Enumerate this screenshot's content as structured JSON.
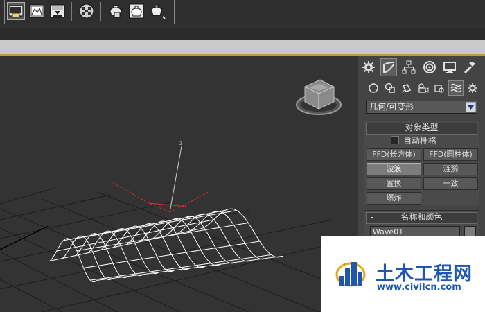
{
  "toolbar": {
    "buttons": [
      "render-setup",
      "rendered-frame-window",
      "render-production",
      "material-editor",
      "render-iterative",
      "render-activeshade",
      "render-teapot"
    ]
  },
  "viewport": {
    "axis_label": "z",
    "colors": {
      "background": "#333333",
      "mesh": "#ffffff",
      "grid": "#1e1e1e",
      "gizmo": "#d83030"
    }
  },
  "panel": {
    "tabs": [
      "create",
      "modify",
      "hierarchy",
      "motion",
      "display",
      "utilities"
    ],
    "subtabs": [
      "geometry",
      "shapes",
      "lights",
      "cameras",
      "helpers",
      "space-warps",
      "systems"
    ],
    "category": "几何/可变形",
    "object_type": {
      "title": "对象类型",
      "minus": "-",
      "autogrid_label": "自动栅格",
      "buttons": [
        "FFD(长方体)",
        "FFD(圆柱体)",
        "波浪",
        "涟漪",
        "置换",
        "一致",
        "爆炸"
      ]
    },
    "name_color": {
      "title": "名称和颜色",
      "minus": "-",
      "name_value": "Wave01"
    }
  },
  "watermark": {
    "title": "土木工程网",
    "url": "www.civilcn.com"
  }
}
